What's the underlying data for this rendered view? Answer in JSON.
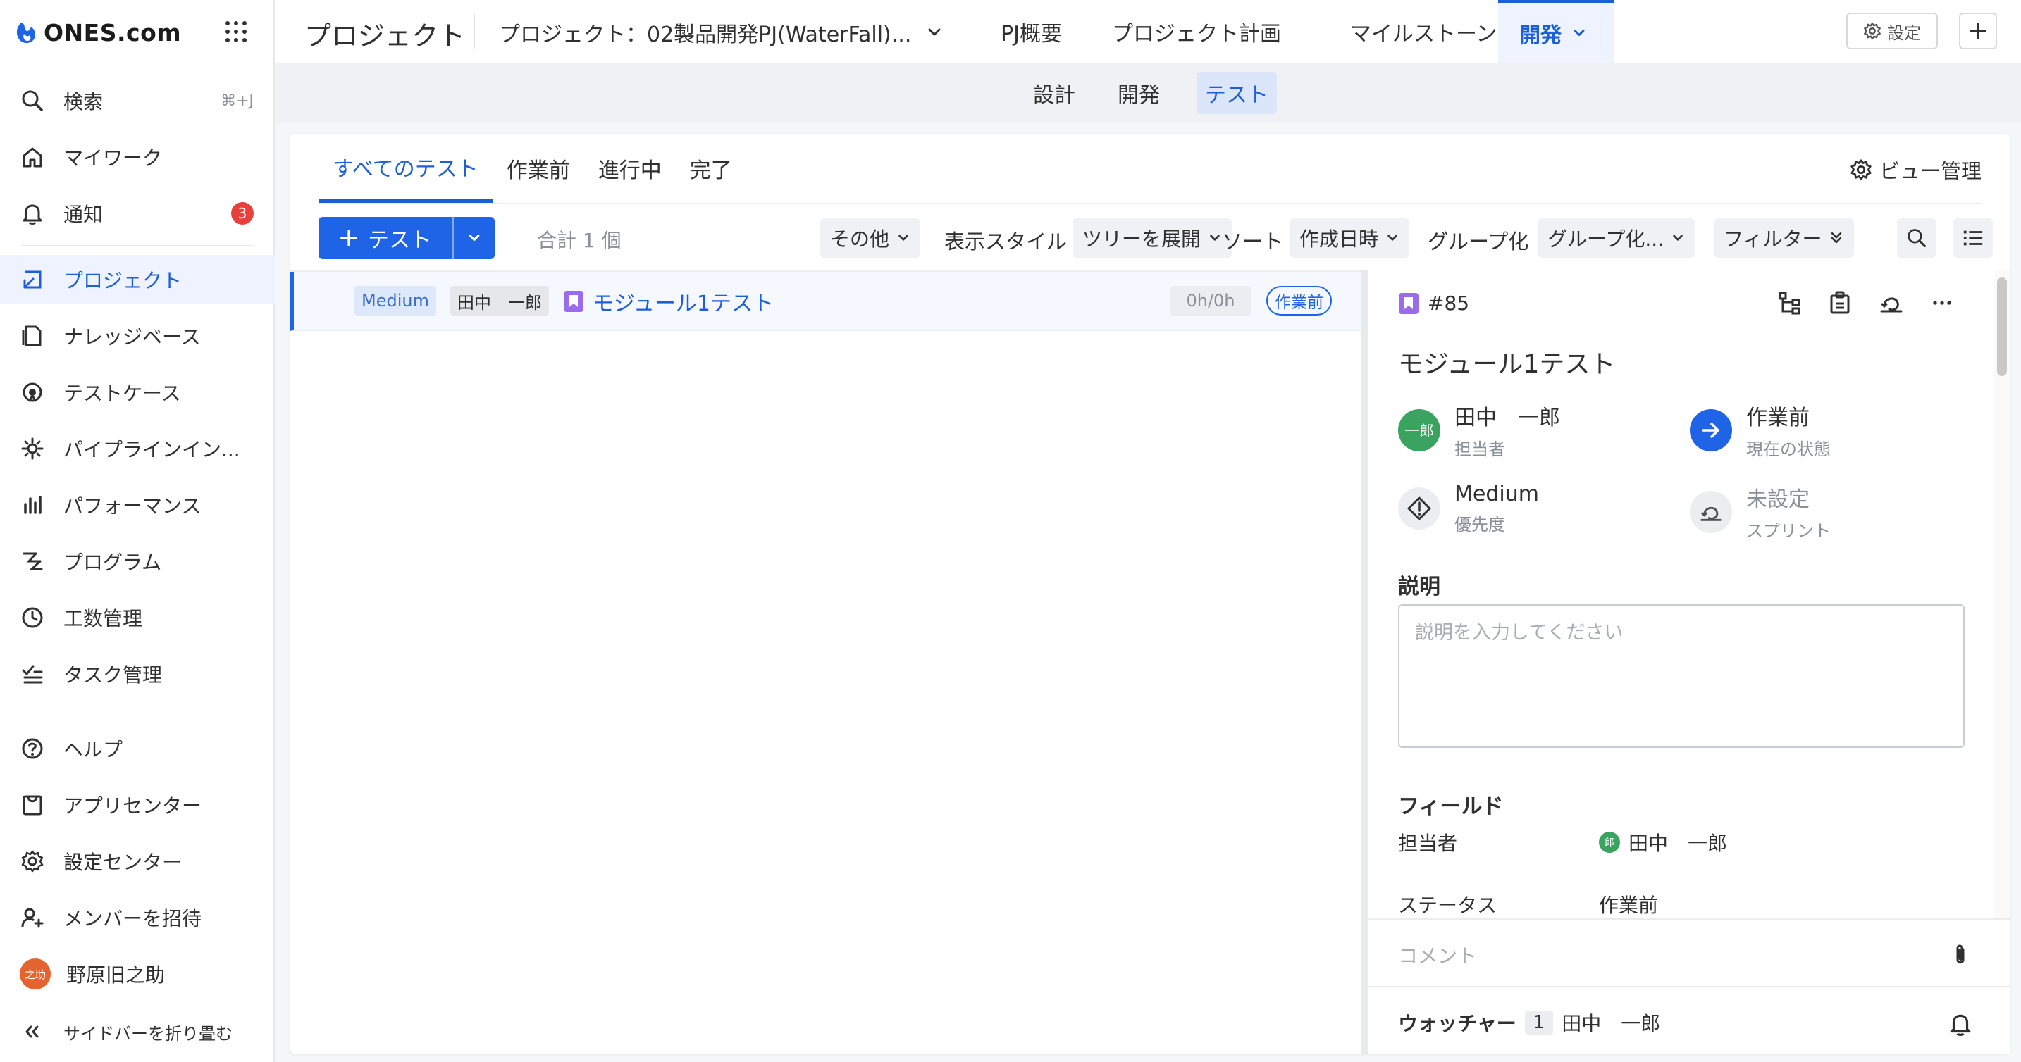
{
  "app": {
    "logo_text": "ONES.com"
  },
  "sidebar": {
    "items": [
      {
        "label": "検索",
        "shortcut": "⌘+J",
        "icon": "search-icon"
      },
      {
        "label": "マイワーク",
        "icon": "home-icon"
      },
      {
        "label": "通知",
        "badge": "3",
        "icon": "bell-icon"
      },
      {
        "label": "プロジェクト",
        "icon": "project-icon"
      },
      {
        "label": "ナレッジベース",
        "icon": "knowledge-icon"
      },
      {
        "label": "テストケース",
        "icon": "testcase-icon"
      },
      {
        "label": "パイプラインイン...",
        "icon": "pipeline-icon"
      },
      {
        "label": "パフォーマンス",
        "icon": "performance-icon"
      },
      {
        "label": "プログラム",
        "icon": "program-icon"
      },
      {
        "label": "工数管理",
        "icon": "clock-icon"
      },
      {
        "label": "タスク管理",
        "icon": "task-icon"
      },
      {
        "label": "ヘルプ",
        "icon": "help-icon"
      },
      {
        "label": "アプリセンター",
        "icon": "app-center-icon"
      },
      {
        "label": "設定センター",
        "icon": "gear-icon"
      },
      {
        "label": "メンバーを招待",
        "icon": "add-user-icon"
      },
      {
        "label": "野原旧之助",
        "avatar_text": "之助"
      },
      {
        "label": "サイドバーを折り畳む",
        "icon": "collapse-icon"
      }
    ]
  },
  "topbar": {
    "title": "プロジェクト",
    "project_select": "プロジェクト：02製品開発PJ(WaterFall)...",
    "tabs": [
      {
        "label": "PJ概要"
      },
      {
        "label": "プロジェクト計画"
      },
      {
        "label": "マイルストーン"
      },
      {
        "label": "開発"
      }
    ],
    "settings_label": "設定"
  },
  "subtabs": [
    {
      "label": "設計"
    },
    {
      "label": "開発"
    },
    {
      "label": "テスト"
    }
  ],
  "view_tabs": [
    {
      "label": "すべてのテスト"
    },
    {
      "label": "作業前"
    },
    {
      "label": "進行中"
    },
    {
      "label": "完了"
    }
  ],
  "view_management": "ビュー管理",
  "toolbar": {
    "add_label": "テスト",
    "total": "合計 1 個",
    "other": "その他",
    "display_style_label": "表示スタイル",
    "display_style_value": "ツリーを展開",
    "sort_label": "ソート",
    "sort_value": "作成日時",
    "group_label": "グループ化",
    "group_value": "グループ化...",
    "filter_label": "フィルター"
  },
  "list": {
    "rows": [
      {
        "priority": "Medium",
        "assignee": "田中　一郎",
        "title": "モジュール1テスト",
        "hours": "0h/0h",
        "status": "作業前"
      }
    ]
  },
  "detail": {
    "id": "#85",
    "title": "モジュール1テスト",
    "assignee": {
      "name": "田中　一郎",
      "label": "担当者",
      "avatar_text": "一郎"
    },
    "state": {
      "value": "作業前",
      "label": "現在の状態"
    },
    "priority": {
      "value": "Medium",
      "label": "優先度"
    },
    "sprint": {
      "value": "未設定",
      "label": "スプリント"
    },
    "description_title": "説明",
    "description_placeholder": "説明を入力してください",
    "fields_title": "フィールド",
    "fields": [
      {
        "label": "担当者",
        "value": "田中　一郎",
        "avatar_text": "郎"
      },
      {
        "label": "ステータス",
        "value": "作業前"
      }
    ],
    "comment_placeholder": "コメント",
    "watchers_label": "ウォッチャー",
    "watchers_count": "1",
    "watchers_name": "田中　一郎"
  },
  "colors": {
    "accent": "#1f63e6",
    "badge": "#e8413c",
    "user_avatar": "#e5632e",
    "assignee_avatar": "#3aa35f"
  }
}
